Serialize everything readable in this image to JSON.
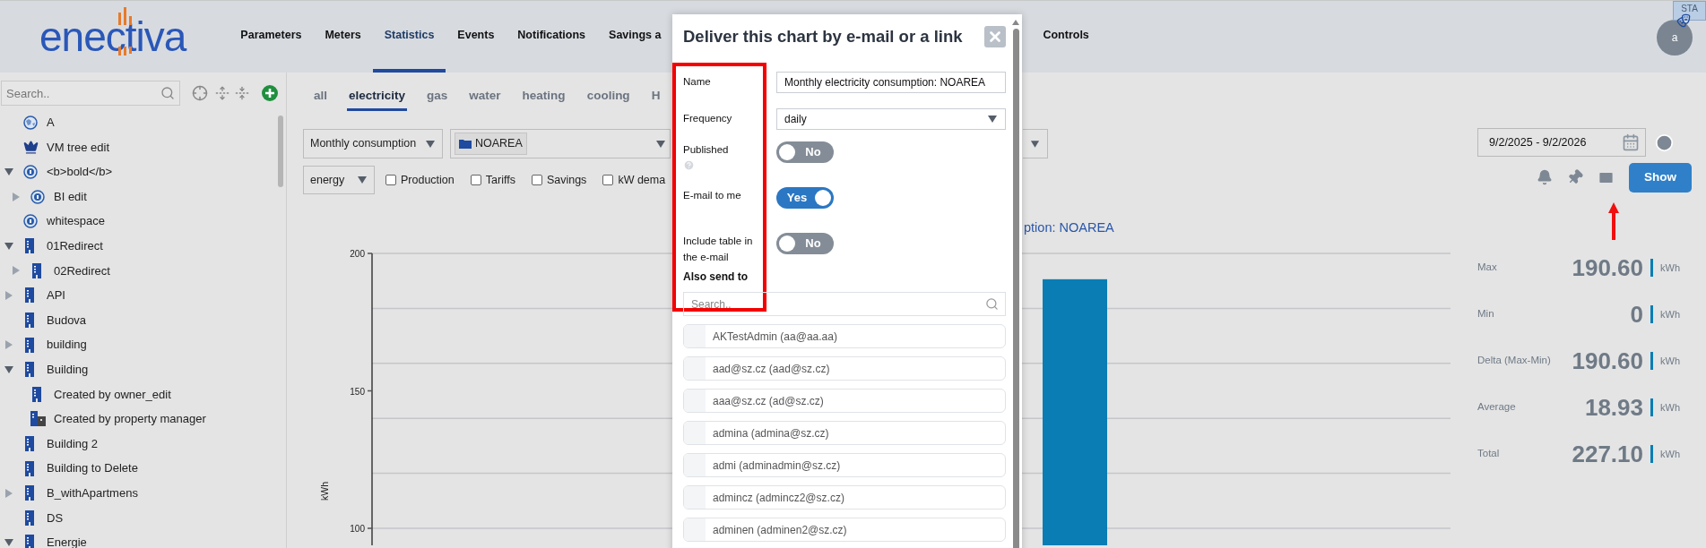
{
  "header": {
    "logo": "enectiva",
    "nav": [
      {
        "label": "Parameters",
        "selected": false
      },
      {
        "label": "Meters",
        "selected": false
      },
      {
        "label": "Statistics",
        "selected": true
      },
      {
        "label": "Events",
        "selected": false
      },
      {
        "label": "Notifications",
        "selected": false
      },
      {
        "label": "Savings a",
        "selected": false
      },
      {
        "label": "Controls",
        "selected": false
      }
    ],
    "badge": "STA",
    "avatar": "a"
  },
  "sidebar": {
    "search": {
      "placeholder": "Search.."
    },
    "tree": [
      {
        "label": "A",
        "kind": "globe",
        "expandable": false
      },
      {
        "label": "VM tree edit",
        "kind": "crown",
        "expandable": false
      },
      {
        "label": "<b>bold</b>",
        "kind": "meter",
        "expandable": true,
        "expanded": true,
        "children": [
          {
            "label": "BI edit",
            "kind": "meter",
            "expandable": true,
            "expanded": false
          }
        ]
      },
      {
        "label": "whitespace",
        "kind": "meter",
        "expandable": false
      },
      {
        "label": "01Redirect",
        "kind": "building",
        "expandable": true,
        "expanded": true,
        "children": [
          {
            "label": "02Redirect",
            "kind": "building",
            "expandable": true,
            "expanded": false
          }
        ]
      },
      {
        "label": "API",
        "kind": "building",
        "expandable": true,
        "expanded": false
      },
      {
        "label": "Budova",
        "kind": "building",
        "expandable": false
      },
      {
        "label": "building",
        "kind": "building",
        "expandable": true,
        "expanded": false
      },
      {
        "label": "Building",
        "kind": "building",
        "expandable": true,
        "expanded": true,
        "children": [
          {
            "label": "Created by owner_edit",
            "kind": "building",
            "expandable": false
          },
          {
            "label": "Created by property manager",
            "kind": "managed",
            "expandable": false
          }
        ]
      },
      {
        "label": "Building 2",
        "kind": "building",
        "expandable": false
      },
      {
        "label": "Building to Delete",
        "kind": "building",
        "expandable": false
      },
      {
        "label": "B_withApartmens",
        "kind": "building",
        "expandable": true,
        "expanded": false
      },
      {
        "label": "DS",
        "kind": "building",
        "expandable": false
      },
      {
        "label": "Energie",
        "kind": "building",
        "expandable": true,
        "expanded": true
      }
    ]
  },
  "tabs": [
    {
      "label": "all",
      "selected": false
    },
    {
      "label": "electricity",
      "selected": true
    },
    {
      "label": "gas",
      "selected": false
    },
    {
      "label": "water",
      "selected": false
    },
    {
      "label": "heating",
      "selected": false
    },
    {
      "label": "cooling",
      "selected": false
    },
    {
      "label": "H",
      "selected": false
    }
  ],
  "filters": {
    "chart_type": "Monthly consumption",
    "area": "NOAREA",
    "quantity": "energy",
    "options": [
      {
        "label": "Production",
        "checked": false
      },
      {
        "label": "Tariffs",
        "checked": false
      },
      {
        "label": "Savings",
        "checked": false
      },
      {
        "label": "kW dema",
        "checked": false
      }
    ]
  },
  "date_range": "9/2/2025 - 9/2/2026",
  "show_button": "Show",
  "chart_title": "ption: NOAREA",
  "chart": {
    "chart_data": {
      "type": "bar",
      "ylabel": "kWh",
      "yticks": [
        100,
        150,
        200
      ],
      "ylim": [
        100,
        200
      ],
      "values": [
        190.6
      ]
    }
  },
  "stats": [
    {
      "label": "Max",
      "value": "190.60",
      "unit": "kWh"
    },
    {
      "label": "Min",
      "value": "0",
      "unit": "kWh"
    },
    {
      "label": "Delta (Max-Min)",
      "value": "190.60",
      "unit": "kWh"
    },
    {
      "label": "Average",
      "value": "18.93",
      "unit": "kWh"
    },
    {
      "label": "Total",
      "value": "227.10",
      "unit": "kWh"
    }
  ],
  "dialog": {
    "title": "Deliver this chart by e-mail or a link",
    "name_label": "Name",
    "name_value": "Monthly electricity consumption: NOAREA",
    "frequency_label": "Frequency",
    "frequency_value": "daily",
    "toggles": [
      {
        "label": "Published",
        "help": true,
        "on": false,
        "text": "No"
      },
      {
        "label": "E-mail to me",
        "help": false,
        "on": true,
        "text": "Yes"
      },
      {
        "label": "Include table in the e-mail",
        "help": false,
        "on": false,
        "text": "No"
      }
    ],
    "also_send_to": "Also send to",
    "search": {
      "placeholder": "Search.."
    },
    "recipients": [
      "AKTestAdmin (aa@aa.aa)",
      "aad@sz.cz (aad@sz.cz)",
      "aaa@sz.cz (ad@sz.cz)",
      "admina (admina@sz.cz)",
      "admi (adminadmin@sz.cz)",
      "admincz (admincz2@sz.cz)",
      "adminen (adminen2@sz.cz)"
    ]
  }
}
